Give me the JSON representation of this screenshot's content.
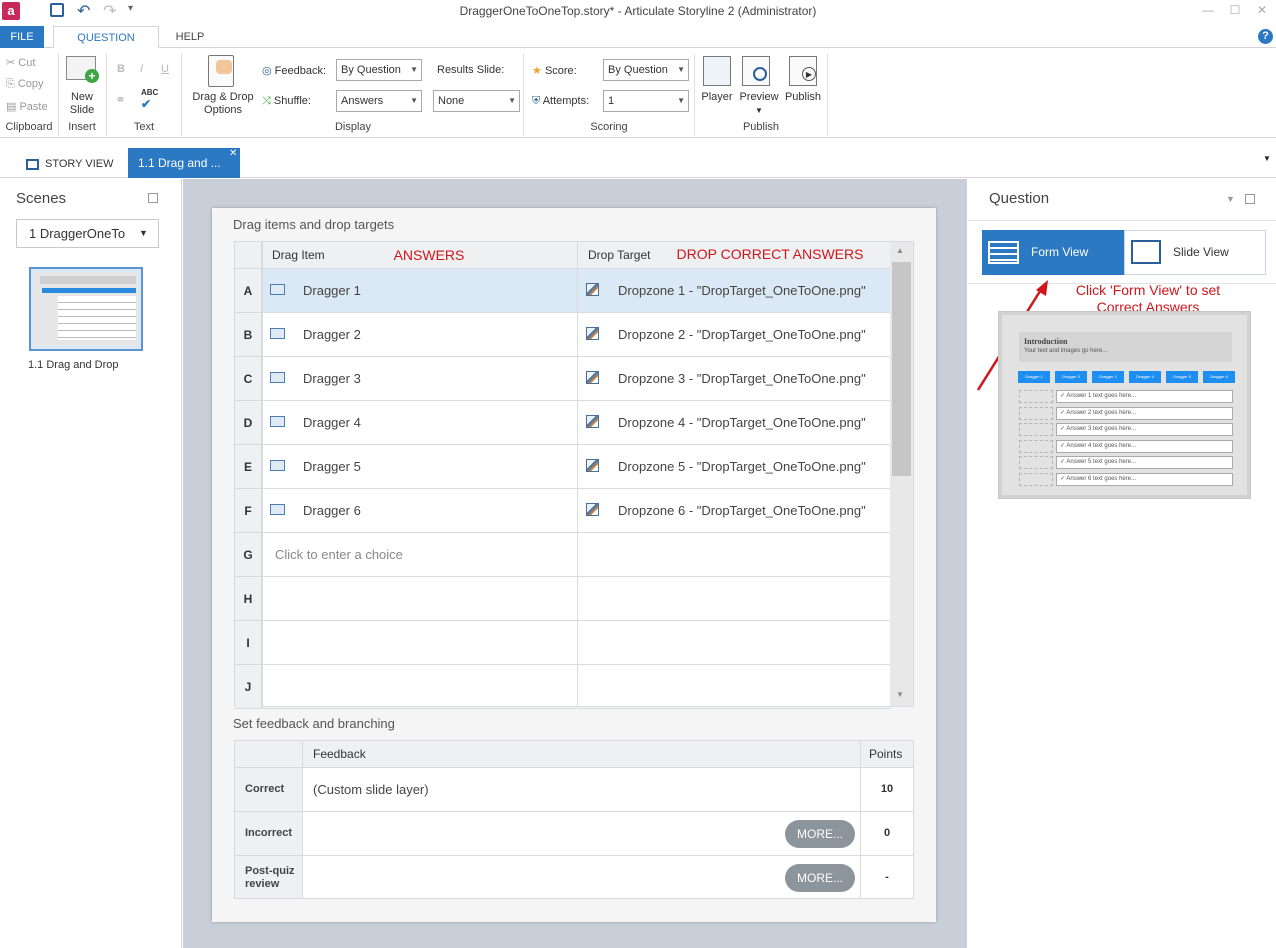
{
  "window": {
    "title": "DraggerOneToOneTop.story* -  Articulate Storyline 2 (Administrator)"
  },
  "menu_tabs": [
    "FILE",
    "QUESTION",
    "HELP"
  ],
  "ribbon": {
    "clipboard": {
      "cut": "Cut",
      "copy": "Copy",
      "paste": "Paste",
      "group": "Clipboard"
    },
    "insert": {
      "new_slide_line1": "New",
      "new_slide_line2": "Slide",
      "group": "Insert"
    },
    "text": {
      "bold": "B",
      "italic": "I",
      "underline": "U",
      "spell": "ABC",
      "group": "Text"
    },
    "display": {
      "dd_line1": "Drag & Drop",
      "dd_line2": "Options",
      "feedback_label": "Feedback:",
      "feedback_value": "By Question",
      "shuffle_label": "Shuffle:",
      "shuffle_value": "Answers",
      "results_label": "Results Slide:",
      "results_value": "None",
      "group": "Display"
    },
    "scoring": {
      "score_label": "Score:",
      "score_value": "By Question",
      "attempts_label": "Attempts:",
      "attempts_value": "1",
      "group": "Scoring"
    },
    "publish": {
      "player": "Player",
      "preview": "Preview",
      "publish": "Publish",
      "group": "Publish"
    }
  },
  "doc_tabs": {
    "story_view": "STORY VIEW",
    "slide_tab": "1.1 Drag and ..."
  },
  "scenes": {
    "title": "Scenes",
    "selected_scene": "1 DraggerOneTo",
    "slide_caption": "1.1 Drag and Drop"
  },
  "form": {
    "section1_title": "Drag items and drop targets",
    "col_drag": "Drag Item",
    "col_drop": "Drop Target",
    "annotation_answers": "ANSWERS",
    "annotation_drop": "DROP CORRECT ANSWERS",
    "rows": [
      {
        "label": "A",
        "drag": "Dragger 1",
        "drop": "Dropzone 1 - \"DropTarget_OneToOne.png\""
      },
      {
        "label": "B",
        "drag": "Dragger 2",
        "drop": "Dropzone 2 - \"DropTarget_OneToOne.png\""
      },
      {
        "label": "C",
        "drag": "Dragger 3",
        "drop": "Dropzone 3 - \"DropTarget_OneToOne.png\""
      },
      {
        "label": "D",
        "drag": "Dragger 4",
        "drop": "Dropzone 4 - \"DropTarget_OneToOne.png\""
      },
      {
        "label": "E",
        "drag": "Dragger 5",
        "drop": "Dropzone 5 - \"DropTarget_OneToOne.png\""
      },
      {
        "label": "F",
        "drag": "Dragger 6",
        "drop": "Dropzone 6 - \"DropTarget_OneToOne.png\""
      },
      {
        "label": "G",
        "drag": "Click to enter a choice",
        "drop": ""
      },
      {
        "label": "H",
        "drag": "",
        "drop": ""
      },
      {
        "label": "I",
        "drag": "",
        "drop": ""
      },
      {
        "label": "J",
        "drag": "",
        "drop": ""
      }
    ],
    "section2_title": "Set feedback and branching",
    "fb_col_feedback": "Feedback",
    "fb_col_points": "Points",
    "feedback_rows": [
      {
        "label": "Correct",
        "feedback": "(Custom slide layer)",
        "points": "10"
      },
      {
        "label": "Incorrect",
        "feedback": "",
        "more": "MORE...",
        "points": "0"
      },
      {
        "label": "Post-quiz review",
        "feedback": "",
        "more": "MORE...",
        "points": "-"
      }
    ]
  },
  "question_panel": {
    "title": "Question",
    "form_view": "Form View",
    "slide_view": "Slide View",
    "annotation_line1": "Click 'Form View' to set",
    "annotation_line2": "Correct Answers",
    "preview": {
      "title": "Introduction",
      "subtitle": "Your text and images go here...",
      "draggers": [
        "Dragger 1",
        "Dragger 3",
        "Dragger 1",
        "Dragger 4",
        "Dragger 5",
        "Dragger 6"
      ],
      "answers": [
        "Answer 1 text goes here...",
        "Answer 2 text goes here...",
        "Answer 3 text goes here...",
        "Answer 4 text goes here...",
        "Answer 5 text goes here...",
        "Answer 6 text goes here..."
      ]
    }
  },
  "colors": {
    "accent": "#2b79c2",
    "annotation": "#d0161b",
    "selected_row": "#dbe8f5"
  }
}
